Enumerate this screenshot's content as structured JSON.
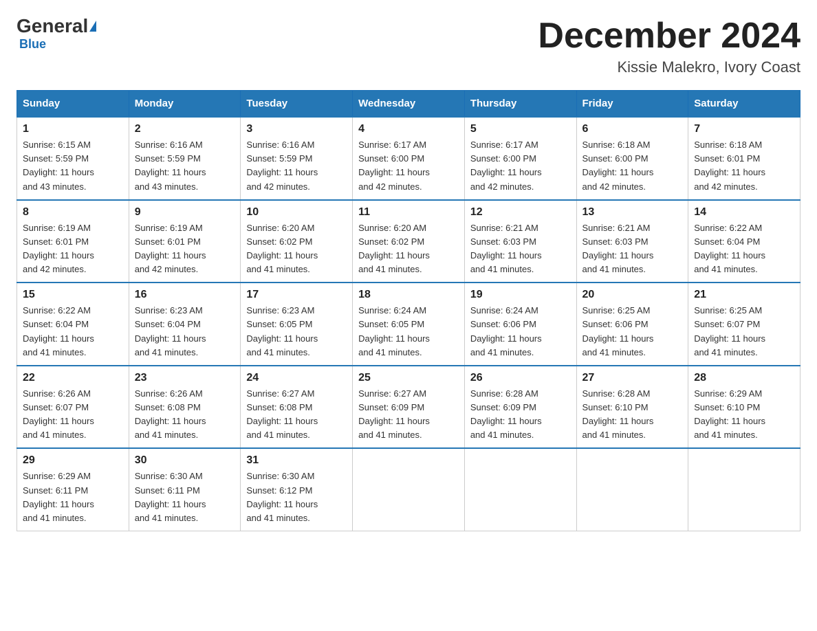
{
  "header": {
    "logo_general": "General",
    "logo_blue": "Blue",
    "month_title": "December 2024",
    "location": "Kissie Malekro, Ivory Coast"
  },
  "weekdays": [
    "Sunday",
    "Monday",
    "Tuesday",
    "Wednesday",
    "Thursday",
    "Friday",
    "Saturday"
  ],
  "weeks": [
    [
      {
        "day": "1",
        "sunrise": "6:15 AM",
        "sunset": "5:59 PM",
        "daylight": "11 hours and 43 minutes."
      },
      {
        "day": "2",
        "sunrise": "6:16 AM",
        "sunset": "5:59 PM",
        "daylight": "11 hours and 43 minutes."
      },
      {
        "day": "3",
        "sunrise": "6:16 AM",
        "sunset": "5:59 PM",
        "daylight": "11 hours and 42 minutes."
      },
      {
        "day": "4",
        "sunrise": "6:17 AM",
        "sunset": "6:00 PM",
        "daylight": "11 hours and 42 minutes."
      },
      {
        "day": "5",
        "sunrise": "6:17 AM",
        "sunset": "6:00 PM",
        "daylight": "11 hours and 42 minutes."
      },
      {
        "day": "6",
        "sunrise": "6:18 AM",
        "sunset": "6:00 PM",
        "daylight": "11 hours and 42 minutes."
      },
      {
        "day": "7",
        "sunrise": "6:18 AM",
        "sunset": "6:01 PM",
        "daylight": "11 hours and 42 minutes."
      }
    ],
    [
      {
        "day": "8",
        "sunrise": "6:19 AM",
        "sunset": "6:01 PM",
        "daylight": "11 hours and 42 minutes."
      },
      {
        "day": "9",
        "sunrise": "6:19 AM",
        "sunset": "6:01 PM",
        "daylight": "11 hours and 42 minutes."
      },
      {
        "day": "10",
        "sunrise": "6:20 AM",
        "sunset": "6:02 PM",
        "daylight": "11 hours and 41 minutes."
      },
      {
        "day": "11",
        "sunrise": "6:20 AM",
        "sunset": "6:02 PM",
        "daylight": "11 hours and 41 minutes."
      },
      {
        "day": "12",
        "sunrise": "6:21 AM",
        "sunset": "6:03 PM",
        "daylight": "11 hours and 41 minutes."
      },
      {
        "day": "13",
        "sunrise": "6:21 AM",
        "sunset": "6:03 PM",
        "daylight": "11 hours and 41 minutes."
      },
      {
        "day": "14",
        "sunrise": "6:22 AM",
        "sunset": "6:04 PM",
        "daylight": "11 hours and 41 minutes."
      }
    ],
    [
      {
        "day": "15",
        "sunrise": "6:22 AM",
        "sunset": "6:04 PM",
        "daylight": "11 hours and 41 minutes."
      },
      {
        "day": "16",
        "sunrise": "6:23 AM",
        "sunset": "6:04 PM",
        "daylight": "11 hours and 41 minutes."
      },
      {
        "day": "17",
        "sunrise": "6:23 AM",
        "sunset": "6:05 PM",
        "daylight": "11 hours and 41 minutes."
      },
      {
        "day": "18",
        "sunrise": "6:24 AM",
        "sunset": "6:05 PM",
        "daylight": "11 hours and 41 minutes."
      },
      {
        "day": "19",
        "sunrise": "6:24 AM",
        "sunset": "6:06 PM",
        "daylight": "11 hours and 41 minutes."
      },
      {
        "day": "20",
        "sunrise": "6:25 AM",
        "sunset": "6:06 PM",
        "daylight": "11 hours and 41 minutes."
      },
      {
        "day": "21",
        "sunrise": "6:25 AM",
        "sunset": "6:07 PM",
        "daylight": "11 hours and 41 minutes."
      }
    ],
    [
      {
        "day": "22",
        "sunrise": "6:26 AM",
        "sunset": "6:07 PM",
        "daylight": "11 hours and 41 minutes."
      },
      {
        "day": "23",
        "sunrise": "6:26 AM",
        "sunset": "6:08 PM",
        "daylight": "11 hours and 41 minutes."
      },
      {
        "day": "24",
        "sunrise": "6:27 AM",
        "sunset": "6:08 PM",
        "daylight": "11 hours and 41 minutes."
      },
      {
        "day": "25",
        "sunrise": "6:27 AM",
        "sunset": "6:09 PM",
        "daylight": "11 hours and 41 minutes."
      },
      {
        "day": "26",
        "sunrise": "6:28 AM",
        "sunset": "6:09 PM",
        "daylight": "11 hours and 41 minutes."
      },
      {
        "day": "27",
        "sunrise": "6:28 AM",
        "sunset": "6:10 PM",
        "daylight": "11 hours and 41 minutes."
      },
      {
        "day": "28",
        "sunrise": "6:29 AM",
        "sunset": "6:10 PM",
        "daylight": "11 hours and 41 minutes."
      }
    ],
    [
      {
        "day": "29",
        "sunrise": "6:29 AM",
        "sunset": "6:11 PM",
        "daylight": "11 hours and 41 minutes."
      },
      {
        "day": "30",
        "sunrise": "6:30 AM",
        "sunset": "6:11 PM",
        "daylight": "11 hours and 41 minutes."
      },
      {
        "day": "31",
        "sunrise": "6:30 AM",
        "sunset": "6:12 PM",
        "daylight": "11 hours and 41 minutes."
      },
      null,
      null,
      null,
      null
    ]
  ],
  "labels": {
    "sunrise": "Sunrise:",
    "sunset": "Sunset:",
    "daylight": "Daylight:"
  }
}
